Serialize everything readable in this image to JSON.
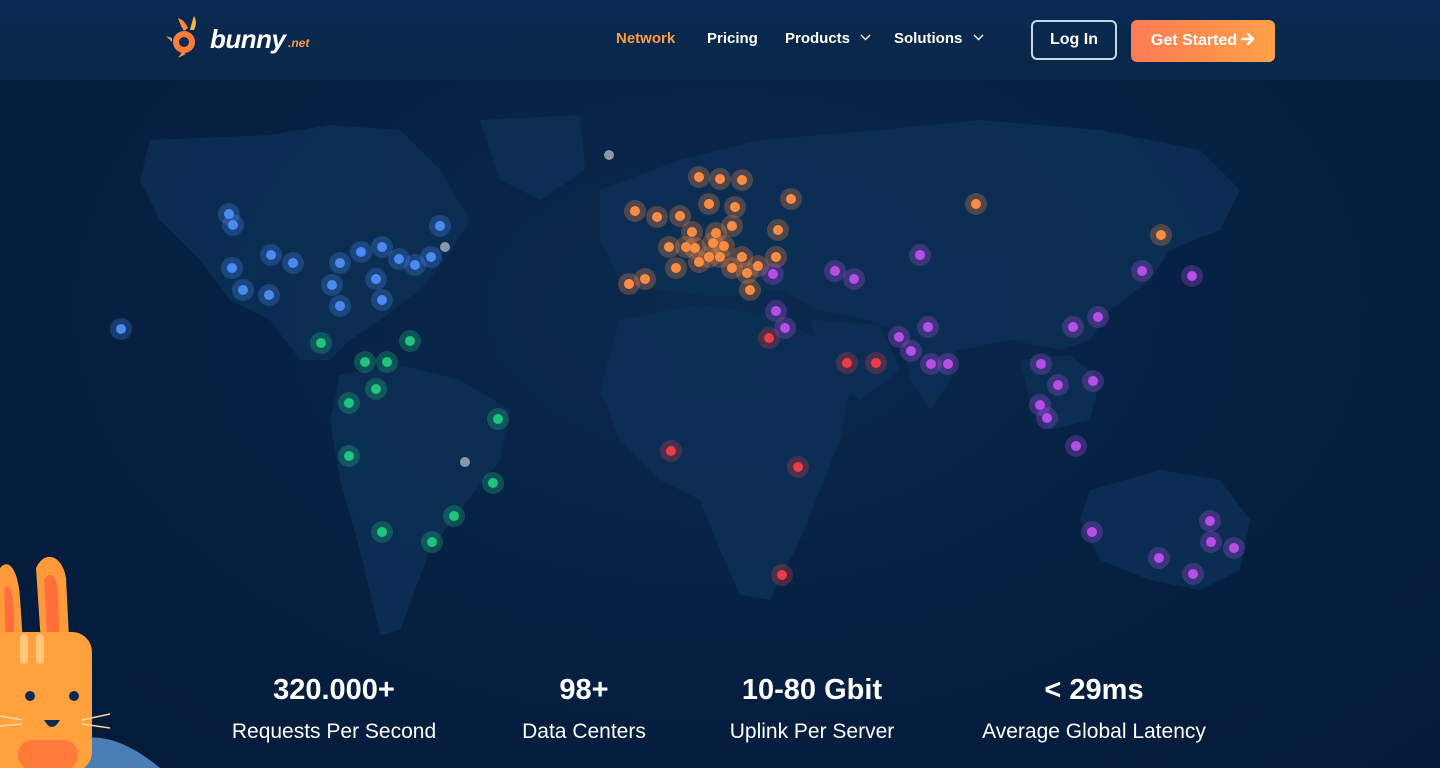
{
  "header": {
    "brand": "bunny",
    "brand_suffix": ".net",
    "nav": [
      {
        "label": "Network",
        "active": true
      },
      {
        "label": "Pricing"
      },
      {
        "label": "Products",
        "dropdown": true
      },
      {
        "label": "Solutions",
        "dropdown": true
      }
    ],
    "login_label": "Log In",
    "cta_label": "Get Started",
    "cta_icon": "arrow-right-icon"
  },
  "stats": [
    {
      "value": "320.000+",
      "label": "Requests Per Second"
    },
    {
      "value": "98+",
      "label": "Data Centers"
    },
    {
      "value": "10-80 Gbit",
      "label": "Uplink Per Server"
    },
    {
      "value": "< 29ms",
      "label": "Average Global Latency"
    }
  ],
  "colors": {
    "accent_orange": "#ff9d3e",
    "north_america": "#4d8af0",
    "south_america": "#1fc47e",
    "europe": "#ff8c42",
    "middle_east_africa": "#ee3b45",
    "asia_oceania": "#b84ee8",
    "inactive": "#8a97a5"
  }
}
